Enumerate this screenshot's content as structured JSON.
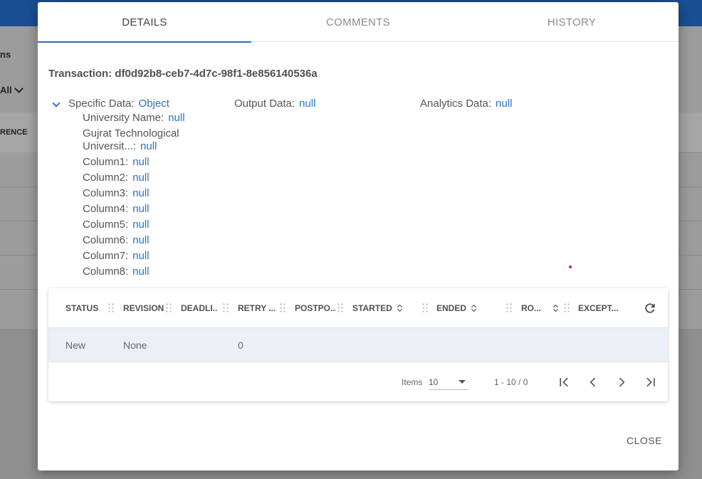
{
  "background": {
    "title_fragment": "ns",
    "filter_fragment": "All",
    "column_fragment": "RENCE"
  },
  "tabs": [
    {
      "label": "DETAILS",
      "active": true
    },
    {
      "label": "COMMENTS",
      "active": false
    },
    {
      "label": "HISTORY",
      "active": false
    }
  ],
  "transaction": {
    "title": "Transaction: df0d92b8-ceb7-4d7c-98f1-8e856140536a"
  },
  "details": {
    "specific": {
      "label": "Specific Data:",
      "value": "Object"
    },
    "output": {
      "label": "Output Data:",
      "value": "null"
    },
    "analytics": {
      "label": "Analytics Data:",
      "value": "null"
    },
    "fields": [
      {
        "label": "University Name:",
        "value": "null"
      },
      {
        "label_line1": "Gujrat Technological",
        "label": "Universit...:",
        "value": "null"
      },
      {
        "label": "Column1:",
        "value": "null"
      },
      {
        "label": "Column2:",
        "value": "null"
      },
      {
        "label": "Column3:",
        "value": "null"
      },
      {
        "label": "Column4:",
        "value": "null"
      },
      {
        "label": "Column5:",
        "value": "null"
      },
      {
        "label": "Column6:",
        "value": "null"
      },
      {
        "label": "Column7:",
        "value": "null"
      },
      {
        "label": "Column8:",
        "value": "null"
      }
    ]
  },
  "table": {
    "columns": [
      "STATUS",
      "REVISION",
      "DEADLI...",
      "RETRY ...",
      "POSTPO...",
      "STARTED",
      "ENDED",
      "RO...",
      "EXCEPT..."
    ],
    "rows": [
      {
        "status": "New",
        "revision": "None",
        "deadline": "",
        "retry": "0",
        "postpone": "",
        "started": "",
        "ended": "",
        "ro": "",
        "exception": ""
      }
    ]
  },
  "pager": {
    "items_label": "Items",
    "page_size": "10",
    "range": "1 - 10 / 0"
  },
  "actions": {
    "close": "CLOSE"
  },
  "colors": {
    "accent": "#2a6cc3",
    "link": "#2a72c8",
    "topbar": "#1a4f93",
    "row_highlight": "#eaf0f5"
  }
}
